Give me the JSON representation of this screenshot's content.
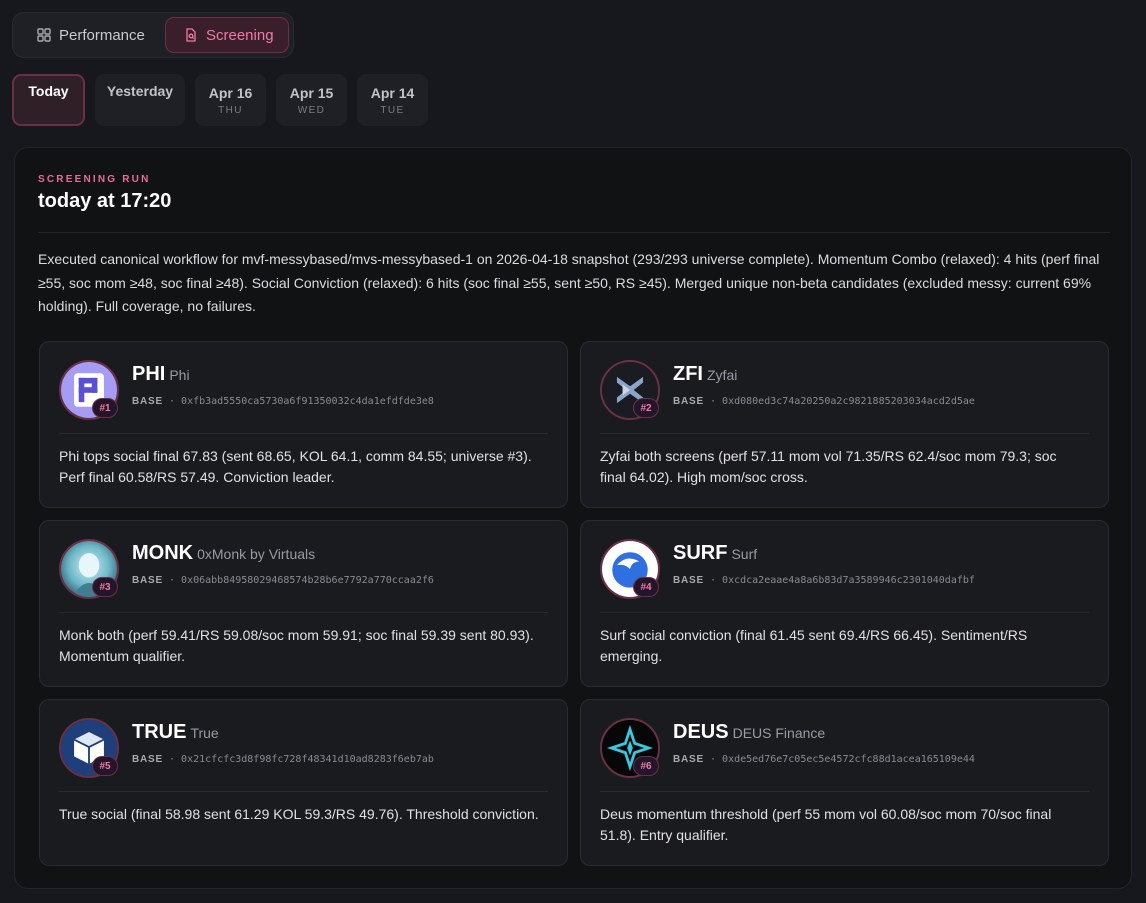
{
  "view_toggle": {
    "performance_label": "Performance",
    "screening_label": "Screening"
  },
  "day_tabs": [
    {
      "label": "Today",
      "dow": ""
    },
    {
      "label": "Yesterday",
      "dow": ""
    },
    {
      "label": "Apr 16",
      "dow": "THU"
    },
    {
      "label": "Apr 15",
      "dow": "WED"
    },
    {
      "label": "Apr 14",
      "dow": "TUE"
    }
  ],
  "run": {
    "label": "SCREENING RUN",
    "title": "today at 17:20",
    "summary": "Executed canonical workflow for mvf-messybased/mvs-messybased-1 on 2026-04-18 snapshot (293/293 universe complete). Momentum Combo (relaxed): 4 hits (perf final ≥55, soc mom ≥48, soc final ≥48). Social Conviction (relaxed): 6 hits (soc final ≥55, sent ≥50, RS ≥45). Merged unique non-beta candidates (excluded messy: current 69% holding). Full coverage, no failures."
  },
  "candidates": [
    {
      "ticker": "PHI",
      "name": "Phi",
      "rank": "#1",
      "chain": "BASE",
      "address": "0xfb3ad5550ca5730a6f91350032c4da1efdfde3e8",
      "note": "Phi tops social final 67.83 (sent 68.65, KOL 64.1, comm 84.55; universe #3). Perf final 60.58/RS 57.49. Conviction leader.",
      "icon": "phi-logo-icon"
    },
    {
      "ticker": "ZFI",
      "name": "Zyfai",
      "rank": "#2",
      "chain": "BASE",
      "address": "0xd080ed3c74a20250a2c9821885203034acd2d5ae",
      "note": "Zyfai both screens (perf 57.11 mom vol 71.35/RS 62.4/soc mom 79.3; soc final 64.02). High mom/soc cross.",
      "icon": "zyfai-logo-icon"
    },
    {
      "ticker": "MONK",
      "name": "0xMonk by Virtuals",
      "rank": "#3",
      "chain": "BASE",
      "address": "0x06abb84958029468574b28b6e7792a770ccaa2f6",
      "note": "Monk both (perf 59.41/RS 59.08/soc mom 59.91; soc final 59.39 sent 80.93). Momentum qualifier.",
      "icon": "monk-avatar-icon"
    },
    {
      "ticker": "SURF",
      "name": "Surf",
      "rank": "#4",
      "chain": "BASE",
      "address": "0xcdca2eaae4a8a6b83d7a3589946c2301040dafbf",
      "note": "Surf social conviction (final 61.45 sent 69.4/RS 66.45). Sentiment/RS emerging.",
      "icon": "surf-logo-icon"
    },
    {
      "ticker": "TRUE",
      "name": "True",
      "rank": "#5",
      "chain": "BASE",
      "address": "0x21cfcfc3d8f98fc728f48341d10ad8283f6eb7ab",
      "note": "True social (final 58.98 sent 61.29 KOL 59.3/RS 49.76). Threshold conviction.",
      "icon": "true-cube-icon"
    },
    {
      "ticker": "DEUS",
      "name": "DEUS Finance",
      "rank": "#6",
      "chain": "BASE",
      "address": "0xde5ed76e7c05ec5e4572cfc88d1acea165109e44",
      "note": "Deus momentum threshold (perf 55 mom vol 60.08/soc mom 70/soc final 51.8). Entry qualifier.",
      "icon": "deus-star-icon"
    }
  ]
}
